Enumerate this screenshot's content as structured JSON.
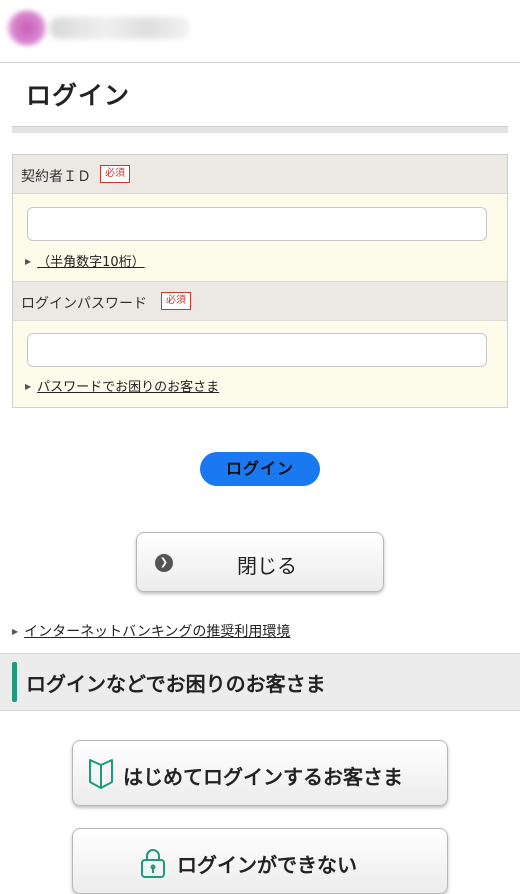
{
  "header": {
    "logo_icon": "brand-logo-icon"
  },
  "page": {
    "title": "ログイン"
  },
  "form": {
    "id_label": "契約者ＩＤ",
    "required_badge": "必須",
    "id_value": "",
    "id_hint": "（半角数字10桁）",
    "password_label": "ログインパスワード",
    "password_value": "",
    "password_hint": "パスワードでお困りのお客さま"
  },
  "actions": {
    "login": "ログイン",
    "close": "閉じる"
  },
  "links": {
    "recommended_env": "インターネットバンキングの推奨利用環境"
  },
  "help_section": {
    "title": "ログインなどでお困りのお客さま",
    "first_time": "はじめてログインするお客さま",
    "cannot_login": "ログインができない"
  },
  "colors": {
    "primary": "#1a78f0",
    "accent_green": "#1f9b7c",
    "required_red": "#d0352b",
    "form_bg": "#fdfbea"
  },
  "icons": [
    "chevron-right-circle-icon",
    "beginner-mark-icon",
    "lock-icon",
    "triangle-bullet-icon"
  ]
}
